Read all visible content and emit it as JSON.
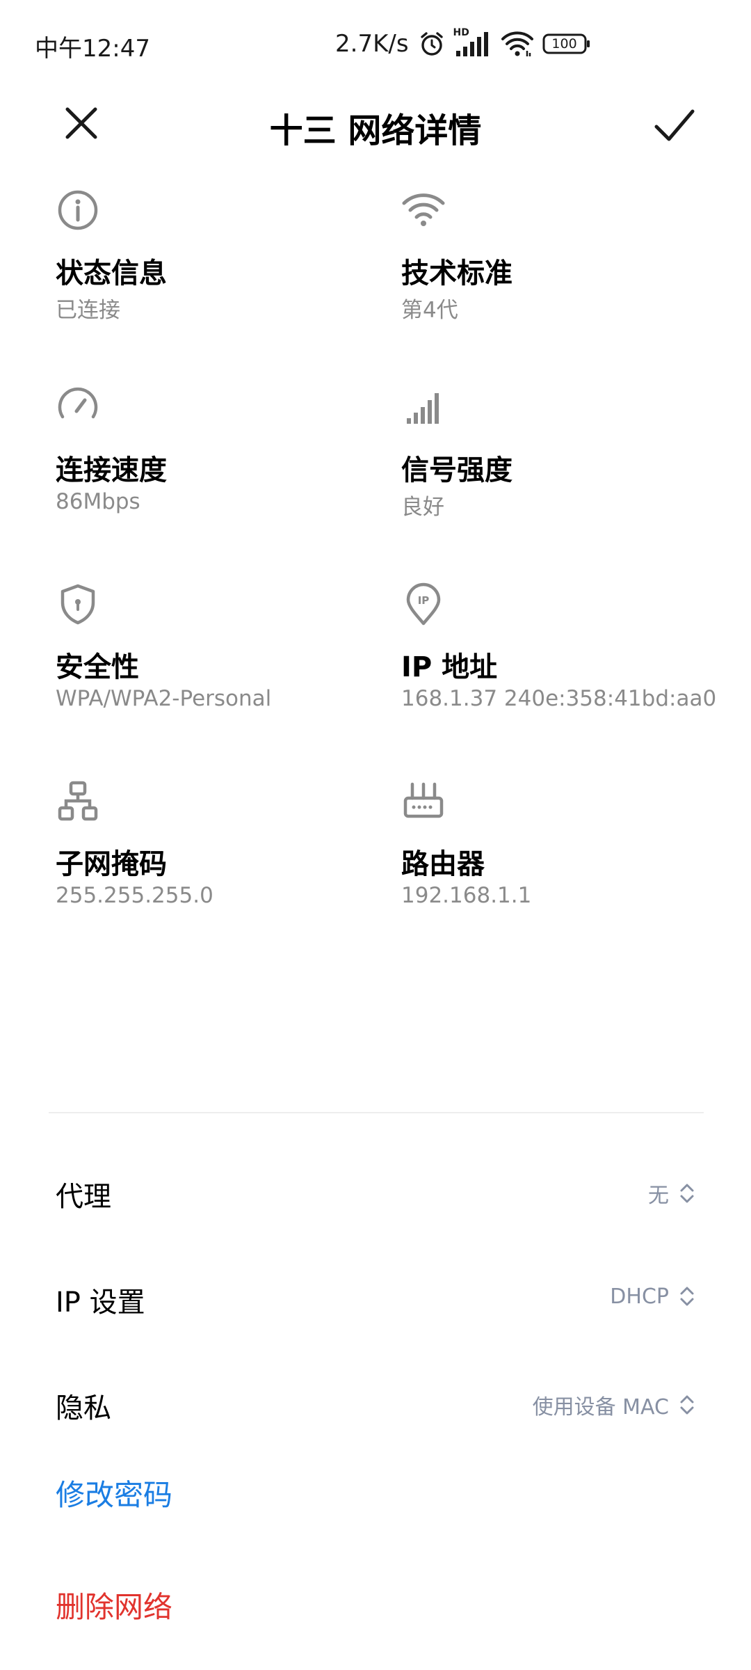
{
  "status_bar": {
    "time": "中午12:47",
    "net_speed": "2.7K/s",
    "hd_badge": "HD",
    "battery": "100"
  },
  "header": {
    "title": "十三 网络详情",
    "close_icon": "close-icon",
    "confirm_icon": "check-icon"
  },
  "info": [
    {
      "icon": "info-icon",
      "label": "状态信息",
      "value": "已连接"
    },
    {
      "icon": "wifi-icon",
      "label": "技术标准",
      "value": "第4代"
    },
    {
      "icon": "speedometer-icon",
      "label": "连接速度",
      "value": "86Mbps"
    },
    {
      "icon": "signal-bars-icon",
      "label": "信号强度",
      "value": "良好"
    },
    {
      "icon": "shield-icon",
      "label": "安全性",
      "value": "WPA/WPA2-Personal"
    },
    {
      "icon": "ip-pin-icon",
      "label": "IP 地址",
      "value": "168.1.37 240e:358:41bd:aa0"
    },
    {
      "icon": "subnet-icon",
      "label": "子网掩码",
      "value": "255.255.255.0"
    },
    {
      "icon": "router-icon",
      "label": "路由器",
      "value": "192.168.1.1"
    }
  ],
  "settings": [
    {
      "label": "代理",
      "value": "无"
    },
    {
      "label": "IP 设置",
      "value": "DHCP"
    },
    {
      "label": "隐私",
      "value": "使用设备 MAC"
    }
  ],
  "actions": {
    "change_password": "修改密码",
    "delete_network": "删除网络"
  },
  "colors": {
    "link_blue": "#1a7de3",
    "danger_red": "#e1332d",
    "secondary_text": "#8a8a8a",
    "setting_value": "#8790a3"
  }
}
